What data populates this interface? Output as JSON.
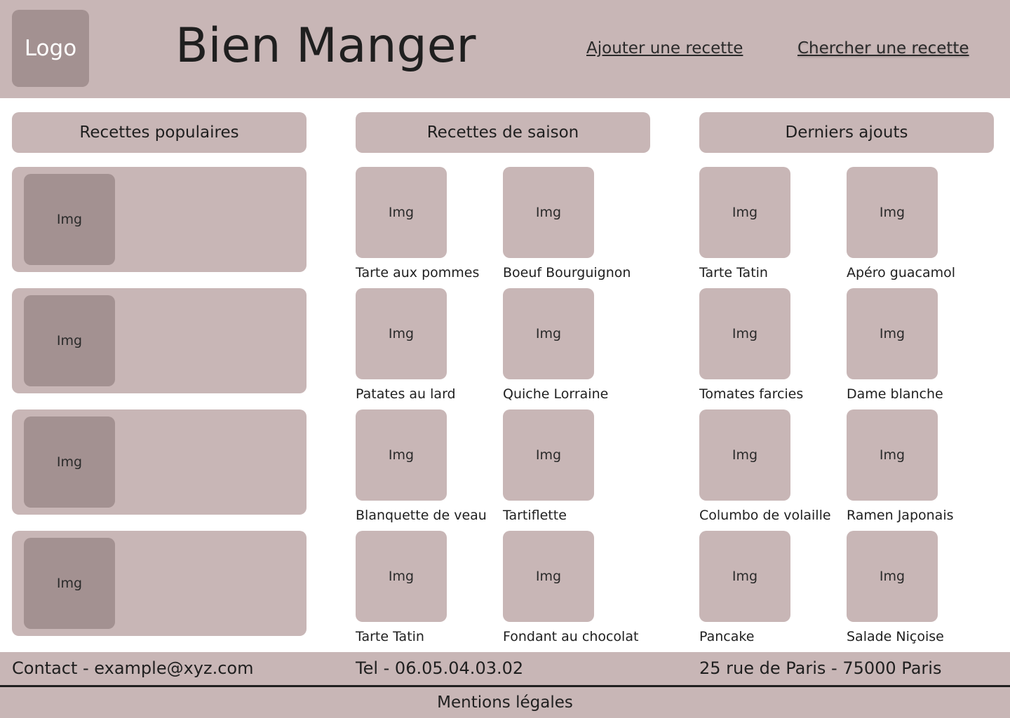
{
  "header": {
    "logo_label": "Logo",
    "title": "Bien Manger",
    "nav": {
      "add_recipe": "Ajouter une recette",
      "search_recipe": "Chercher une recette"
    }
  },
  "columns": {
    "popular": {
      "title": "Recettes populaires",
      "cards": [
        {
          "img": "Img"
        },
        {
          "img": "Img"
        },
        {
          "img": "Img"
        },
        {
          "img": "Img"
        }
      ]
    },
    "seasonal": {
      "title": "Recettes de saison",
      "items": [
        {
          "img": "Img",
          "label": "Tarte aux pommes"
        },
        {
          "img": "Img",
          "label": "Boeuf Bourguignon"
        },
        {
          "img": "Img",
          "label": "Patates au lard"
        },
        {
          "img": "Img",
          "label": "Quiche Lorraine"
        },
        {
          "img": "Img",
          "label": "Blanquette de veau"
        },
        {
          "img": "Img",
          "label": "Tartiflette"
        },
        {
          "img": "Img",
          "label": "Tarte Tatin"
        },
        {
          "img": "Img",
          "label": "Fondant au chocolat"
        }
      ]
    },
    "latest": {
      "title": "Derniers ajouts",
      "items": [
        {
          "img": "Img",
          "label": "Tarte Tatin"
        },
        {
          "img": "Img",
          "label": "Apéro guacamol"
        },
        {
          "img": "Img",
          "label": "Tomates farcies"
        },
        {
          "img": "Img",
          "label": "Dame blanche"
        },
        {
          "img": "Img",
          "label": "Columbo de volaille"
        },
        {
          "img": "Img",
          "label": "Ramen Japonais"
        },
        {
          "img": "Img",
          "label": "Pancake"
        },
        {
          "img": "Img",
          "label": "Salade Niçoise"
        }
      ]
    }
  },
  "footer": {
    "contact": "Contact - example@xyz.com",
    "phone": "Tel - 06.05.04.03.02",
    "address": "25 rue de Paris - 75000 Paris",
    "legal": "Mentions légales"
  },
  "colors": {
    "panel": "#c8b6b6",
    "placeholder_dark": "#a39191",
    "text": "#1f1f1f",
    "background": "#ffffff"
  }
}
